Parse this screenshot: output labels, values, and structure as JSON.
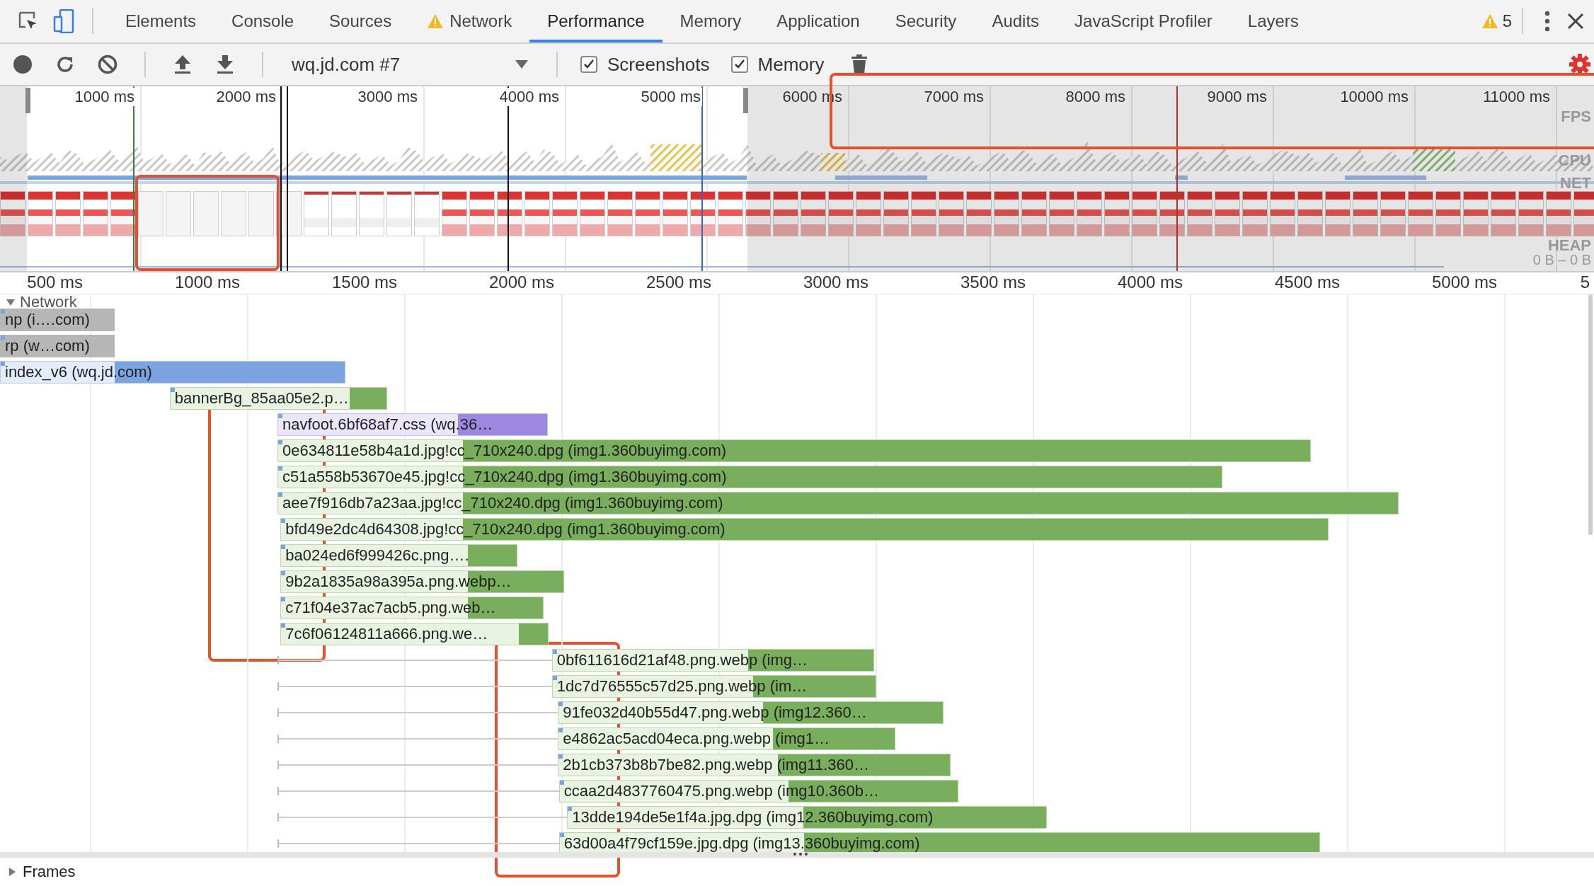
{
  "tabs": [
    {
      "label": "Elements",
      "selected": false,
      "warning": false
    },
    {
      "label": "Console",
      "selected": false,
      "warning": false
    },
    {
      "label": "Sources",
      "selected": false,
      "warning": false
    },
    {
      "label": "Network",
      "selected": false,
      "warning": true
    },
    {
      "label": "Performance",
      "selected": true,
      "warning": false
    },
    {
      "label": "Memory",
      "selected": false,
      "warning": false
    },
    {
      "label": "Application",
      "selected": false,
      "warning": false
    },
    {
      "label": "Security",
      "selected": false,
      "warning": false
    },
    {
      "label": "Audits",
      "selected": false,
      "warning": false
    },
    {
      "label": "JavaScript Profiler",
      "selected": false,
      "warning": false
    },
    {
      "label": "Layers",
      "selected": false,
      "warning": false
    }
  ],
  "issues": {
    "count": "5"
  },
  "toolbar": {
    "recording": "wq.jd.com #7",
    "checkboxes": [
      {
        "label": "Screenshots",
        "checked": true
      },
      {
        "label": "Memory",
        "checked": true
      }
    ]
  },
  "overview": {
    "ticks": [
      "1000 ms",
      "2000 ms",
      "3000 ms",
      "4000 ms",
      "5000 ms",
      "6000 ms",
      "7000 ms",
      "8000 ms",
      "9000 ms",
      "10000 ms",
      "11000 ms"
    ],
    "lanes": [
      "FPS",
      "CPU",
      "NET",
      "HEAP"
    ],
    "heap_range": "0 B – 0 B"
  },
  "ruler": {
    "ticks": [
      "500 ms",
      "1000 ms",
      "1500 ms",
      "2000 ms",
      "2500 ms",
      "3000 ms",
      "3500 ms",
      "4000 ms",
      "4500 ms",
      "5000 ms",
      "5"
    ]
  },
  "network": {
    "title": "Network",
    "expanded": true,
    "requests": [
      {
        "label": "np (i….com)",
        "kind": "other"
      },
      {
        "label": "rp (w…com)",
        "kind": "other"
      },
      {
        "label": "index_v6 (wq.jd.com)",
        "kind": "document"
      },
      {
        "label": "bannerBg_85aa05e2.p…",
        "kind": "image"
      },
      {
        "label": "navfoot.6bf68af7.css (wq.36…",
        "kind": "stylesheet"
      },
      {
        "label": "0e634811e58b4a1d.jpg!cc_710x240.dpg (img1.360buyimg.com)",
        "kind": "image"
      },
      {
        "label": "c51a558b53670e45.jpg!cc_710x240.dpg (img1.360buyimg.com)",
        "kind": "image"
      },
      {
        "label": "aee7f916db7a23aa.jpg!cc_710x240.dpg (img1.360buyimg.com)",
        "kind": "image"
      },
      {
        "label": "bfd49e2dc4d64308.jpg!cc_710x240.dpg (img1.360buyimg.com)",
        "kind": "image"
      },
      {
        "label": "ba024ed6f999426c.png….",
        "kind": "image"
      },
      {
        "label": "9b2a1835a98a395a.png.webp…",
        "kind": "image"
      },
      {
        "label": "c71f04e37ac7acb5.png.web…",
        "kind": "image"
      },
      {
        "label": "7c6f06124811a666.png.we…",
        "kind": "image"
      },
      {
        "label": "0bf611616d21af48.png.webp (img…",
        "kind": "image"
      },
      {
        "label": "1dc7d76555c57d25.png.webp (im…",
        "kind": "image"
      },
      {
        "label": "91fe032d40b55d47.png.webp (img12.360…",
        "kind": "image"
      },
      {
        "label": "e4862ac5acd04eca.png.webp (img1…",
        "kind": "image"
      },
      {
        "label": "2b1cb373b8b7be82.png.webp (img11.360…",
        "kind": "image"
      },
      {
        "label": "ccaa2d4837760475.png.webp (img10.360b…",
        "kind": "image"
      },
      {
        "label": "13dde194de5e1f4a.jpg.dpg (img12.360buyimg.com)",
        "kind": "image"
      },
      {
        "label": "63d00a4f79cf159e.jpg.dpg (img13.360buyimg.com)",
        "kind": "image"
      }
    ]
  },
  "frames": {
    "title": "Frames",
    "expanded": false
  }
}
